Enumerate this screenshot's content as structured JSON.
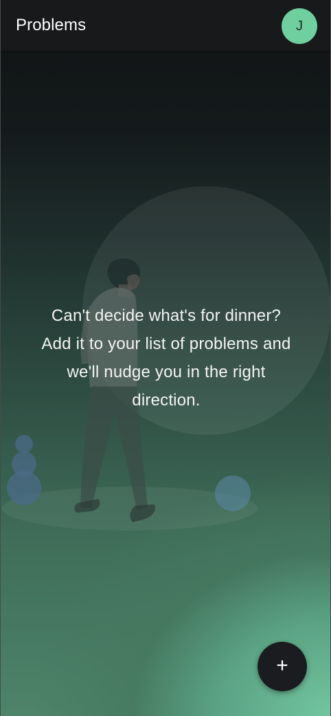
{
  "header": {
    "title": "Problems",
    "avatar_initial": "J"
  },
  "empty_state": {
    "lines": [
      "Can't decide what's for dinner?",
      "Add it to your list of problems and",
      "we'll nudge you in the right",
      "direction."
    ]
  },
  "fab": {
    "icon": "plus-icon",
    "symbol": "+"
  },
  "colors": {
    "accent": "#6fcf9f",
    "header_bg": "#18191b",
    "fab_bg": "#1b1c1f",
    "text": "#f4f4f4"
  }
}
